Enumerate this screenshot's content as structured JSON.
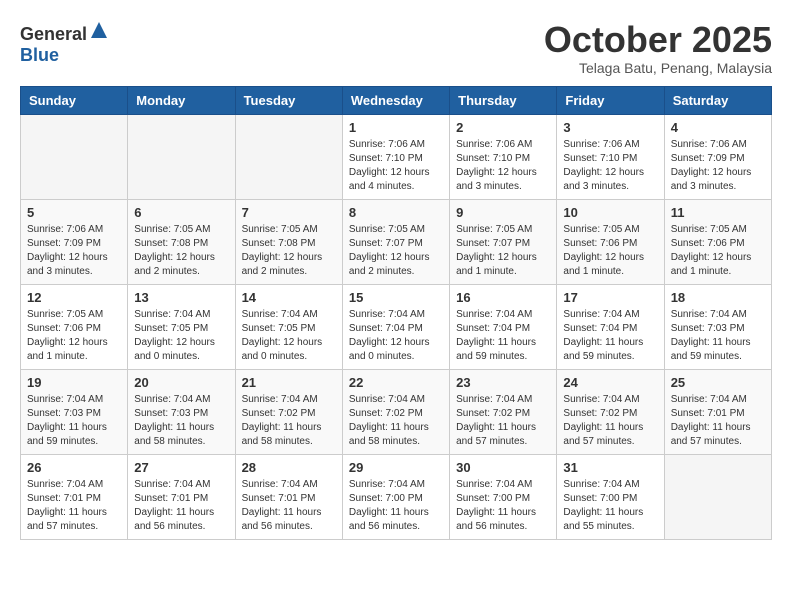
{
  "logo": {
    "text_general": "General",
    "text_blue": "Blue"
  },
  "header": {
    "month_title": "October 2025",
    "location": "Telaga Batu, Penang, Malaysia"
  },
  "days_of_week": [
    "Sunday",
    "Monday",
    "Tuesday",
    "Wednesday",
    "Thursday",
    "Friday",
    "Saturday"
  ],
  "weeks": [
    [
      {
        "day": "",
        "info": ""
      },
      {
        "day": "",
        "info": ""
      },
      {
        "day": "",
        "info": ""
      },
      {
        "day": "1",
        "info": "Sunrise: 7:06 AM\nSunset: 7:10 PM\nDaylight: 12 hours\nand 4 minutes."
      },
      {
        "day": "2",
        "info": "Sunrise: 7:06 AM\nSunset: 7:10 PM\nDaylight: 12 hours\nand 3 minutes."
      },
      {
        "day": "3",
        "info": "Sunrise: 7:06 AM\nSunset: 7:10 PM\nDaylight: 12 hours\nand 3 minutes."
      },
      {
        "day": "4",
        "info": "Sunrise: 7:06 AM\nSunset: 7:09 PM\nDaylight: 12 hours\nand 3 minutes."
      }
    ],
    [
      {
        "day": "5",
        "info": "Sunrise: 7:06 AM\nSunset: 7:09 PM\nDaylight: 12 hours\nand 3 minutes."
      },
      {
        "day": "6",
        "info": "Sunrise: 7:05 AM\nSunset: 7:08 PM\nDaylight: 12 hours\nand 2 minutes."
      },
      {
        "day": "7",
        "info": "Sunrise: 7:05 AM\nSunset: 7:08 PM\nDaylight: 12 hours\nand 2 minutes."
      },
      {
        "day": "8",
        "info": "Sunrise: 7:05 AM\nSunset: 7:07 PM\nDaylight: 12 hours\nand 2 minutes."
      },
      {
        "day": "9",
        "info": "Sunrise: 7:05 AM\nSunset: 7:07 PM\nDaylight: 12 hours\nand 1 minute."
      },
      {
        "day": "10",
        "info": "Sunrise: 7:05 AM\nSunset: 7:06 PM\nDaylight: 12 hours\nand 1 minute."
      },
      {
        "day": "11",
        "info": "Sunrise: 7:05 AM\nSunset: 7:06 PM\nDaylight: 12 hours\nand 1 minute."
      }
    ],
    [
      {
        "day": "12",
        "info": "Sunrise: 7:05 AM\nSunset: 7:06 PM\nDaylight: 12 hours\nand 1 minute."
      },
      {
        "day": "13",
        "info": "Sunrise: 7:04 AM\nSunset: 7:05 PM\nDaylight: 12 hours\nand 0 minutes."
      },
      {
        "day": "14",
        "info": "Sunrise: 7:04 AM\nSunset: 7:05 PM\nDaylight: 12 hours\nand 0 minutes."
      },
      {
        "day": "15",
        "info": "Sunrise: 7:04 AM\nSunset: 7:04 PM\nDaylight: 12 hours\nand 0 minutes."
      },
      {
        "day": "16",
        "info": "Sunrise: 7:04 AM\nSunset: 7:04 PM\nDaylight: 11 hours\nand 59 minutes."
      },
      {
        "day": "17",
        "info": "Sunrise: 7:04 AM\nSunset: 7:04 PM\nDaylight: 11 hours\nand 59 minutes."
      },
      {
        "day": "18",
        "info": "Sunrise: 7:04 AM\nSunset: 7:03 PM\nDaylight: 11 hours\nand 59 minutes."
      }
    ],
    [
      {
        "day": "19",
        "info": "Sunrise: 7:04 AM\nSunset: 7:03 PM\nDaylight: 11 hours\nand 59 minutes."
      },
      {
        "day": "20",
        "info": "Sunrise: 7:04 AM\nSunset: 7:03 PM\nDaylight: 11 hours\nand 58 minutes."
      },
      {
        "day": "21",
        "info": "Sunrise: 7:04 AM\nSunset: 7:02 PM\nDaylight: 11 hours\nand 58 minutes."
      },
      {
        "day": "22",
        "info": "Sunrise: 7:04 AM\nSunset: 7:02 PM\nDaylight: 11 hours\nand 58 minutes."
      },
      {
        "day": "23",
        "info": "Sunrise: 7:04 AM\nSunset: 7:02 PM\nDaylight: 11 hours\nand 57 minutes."
      },
      {
        "day": "24",
        "info": "Sunrise: 7:04 AM\nSunset: 7:02 PM\nDaylight: 11 hours\nand 57 minutes."
      },
      {
        "day": "25",
        "info": "Sunrise: 7:04 AM\nSunset: 7:01 PM\nDaylight: 11 hours\nand 57 minutes."
      }
    ],
    [
      {
        "day": "26",
        "info": "Sunrise: 7:04 AM\nSunset: 7:01 PM\nDaylight: 11 hours\nand 57 minutes."
      },
      {
        "day": "27",
        "info": "Sunrise: 7:04 AM\nSunset: 7:01 PM\nDaylight: 11 hours\nand 56 minutes."
      },
      {
        "day": "28",
        "info": "Sunrise: 7:04 AM\nSunset: 7:01 PM\nDaylight: 11 hours\nand 56 minutes."
      },
      {
        "day": "29",
        "info": "Sunrise: 7:04 AM\nSunset: 7:00 PM\nDaylight: 11 hours\nand 56 minutes."
      },
      {
        "day": "30",
        "info": "Sunrise: 7:04 AM\nSunset: 7:00 PM\nDaylight: 11 hours\nand 56 minutes."
      },
      {
        "day": "31",
        "info": "Sunrise: 7:04 AM\nSunset: 7:00 PM\nDaylight: 11 hours\nand 55 minutes."
      },
      {
        "day": "",
        "info": ""
      }
    ]
  ]
}
